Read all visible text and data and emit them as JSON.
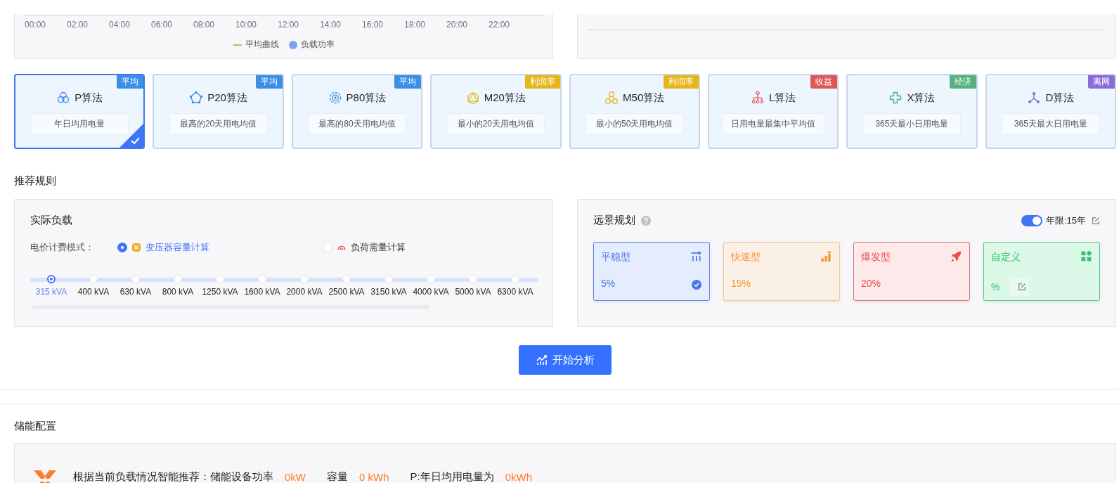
{
  "load_chart": {
    "x_labels": [
      "00:00",
      "02:00",
      "04:00",
      "06:00",
      "08:00",
      "10:00",
      "12:00",
      "14:00",
      "16:00",
      "18:00",
      "20:00",
      "22:00"
    ],
    "legend": [
      {
        "kind": "line",
        "label": "平均曲线",
        "color": "#91cc75"
      },
      {
        "kind": "dot",
        "label": "负载功率",
        "color": "#7ea3f3"
      }
    ]
  },
  "algorithms": [
    {
      "kind": "circles",
      "name": "P算法",
      "description": "年日均用电量",
      "badge": "平均",
      "color": "#3a8ee6",
      "selected": true
    },
    {
      "kind": "pentagon",
      "name": "P20算法",
      "description": "最高的20天用电均值",
      "badge": "平均",
      "color": "#3a8ee6",
      "selected": false
    },
    {
      "kind": "target",
      "name": "P80算法",
      "description": "最高的80天用电均值",
      "badge": "平均",
      "color": "#3a8ee6",
      "selected": false
    },
    {
      "kind": "triangle",
      "name": "M20算法",
      "description": "最小的20天用电均值",
      "badge": "利润率",
      "color": "#e6b619",
      "selected": false
    },
    {
      "kind": "triad",
      "name": "M50算法",
      "description": "最小的50天用电均值",
      "badge": "利润率",
      "color": "#e6b619",
      "selected": false
    },
    {
      "kind": "tree",
      "name": "L算法",
      "description": "日用电量最集中平均值",
      "badge": "收益",
      "color": "#e05656",
      "selected": false
    },
    {
      "kind": "cross",
      "name": "X算法",
      "description": "365天最小日用电量",
      "badge": "经济",
      "color": "#56b07f",
      "selected": false
    },
    {
      "kind": "molecule",
      "name": "D算法",
      "description": "365天最大日用电量",
      "badge": "离网",
      "color": "#8c6bd8",
      "selected": false
    }
  ],
  "rules_title": "推荐规则",
  "actual_load": {
    "title": "实际负载",
    "mode_label": "电价计费模式：",
    "modes": [
      {
        "kind": "chip",
        "label": "变压器容量计算",
        "selected": true
      },
      {
        "kind": "gauge",
        "label": "负荷需量计算",
        "selected": false
      }
    ],
    "capacities": [
      {
        "label": "315 kVA",
        "selected": true
      },
      {
        "label": "400 kVA",
        "selected": false
      },
      {
        "label": "630 kVA",
        "selected": false
      },
      {
        "label": "800 kVA",
        "selected": false
      },
      {
        "label": "1250 kVA",
        "selected": false
      },
      {
        "label": "1600 kVA",
        "selected": false
      },
      {
        "label": "2000 kVA",
        "selected": false
      },
      {
        "label": "2500 kVA",
        "selected": false
      },
      {
        "label": "3150 kVA",
        "selected": false
      },
      {
        "label": "4000 kVA",
        "selected": false
      },
      {
        "label": "5000 kVA",
        "selected": false
      },
      {
        "label": "6300 kVA",
        "selected": false
      }
    ]
  },
  "outlook": {
    "title": "远景规划",
    "years_toggle": true,
    "years_label": "年限:15年",
    "plans": [
      {
        "kind": "steady",
        "name": "平稳型",
        "value": "5%",
        "selected": true
      },
      {
        "kind": "fast",
        "name": "快速型",
        "value": "15%",
        "selected": false
      },
      {
        "kind": "burst",
        "name": "爆发型",
        "value": "20%",
        "selected": false
      },
      {
        "kind": "custom",
        "name": "自定义",
        "value": "%",
        "selected": false
      }
    ]
  },
  "analyze_button": "开始分析",
  "storage": {
    "title": "储能配置",
    "recommend_text": "根据当前负载情况智能推荐：储能设备功率",
    "power_value": "0kW",
    "capacity_label": "容量",
    "capacity_value": "0 kWh",
    "basis_label": "P:年日均用电量为",
    "basis_value": "0kWh"
  }
}
